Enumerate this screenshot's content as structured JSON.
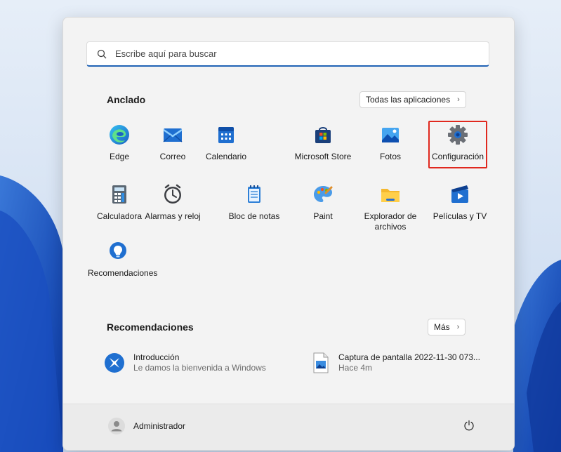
{
  "search": {
    "placeholder": "Escribe aquí para buscar"
  },
  "pinned": {
    "title": "Anclado",
    "all_apps_label": "Todas las aplicaciones",
    "apps": [
      {
        "label": "Edge",
        "icon": "edge-icon"
      },
      {
        "label": "Correo",
        "icon": "mail-icon"
      },
      {
        "label": "Calendario",
        "icon": "calendar-icon"
      },
      {
        "label": "Microsoft Store",
        "icon": "store-icon"
      },
      {
        "label": "Fotos",
        "icon": "photos-icon"
      },
      {
        "label": "Configuración",
        "icon": "gear-icon",
        "highlighted": true
      },
      {
        "label": "Calculadora",
        "icon": "calculator-icon"
      },
      {
        "label": "Alarmas y reloj",
        "icon": "clock-icon"
      },
      {
        "label": "Bloc de notas",
        "icon": "notepad-icon"
      },
      {
        "label": "Paint",
        "icon": "palette-icon"
      },
      {
        "label": "Explorador de archivos",
        "icon": "folder-icon"
      },
      {
        "label": "Películas y TV",
        "icon": "movies-icon"
      },
      {
        "label": "Recomendaciones",
        "icon": "tips-icon"
      }
    ]
  },
  "recommended": {
    "title": "Recomendaciones",
    "more_label": "Más",
    "items": [
      {
        "title": "Introducción",
        "subtitle": "Le damos la bienvenida a Windows",
        "icon": "get-started-icon"
      },
      {
        "title": "Captura de pantalla 2022-11-30 073...",
        "subtitle": "Hace 4m",
        "icon": "image-file-icon"
      }
    ]
  },
  "footer": {
    "user_name": "Administrador",
    "power_icon": "power-icon"
  },
  "colors": {
    "accent": "#1f62b5",
    "highlight_border": "#e0281e",
    "menu_bg": "#f3f3f3"
  }
}
